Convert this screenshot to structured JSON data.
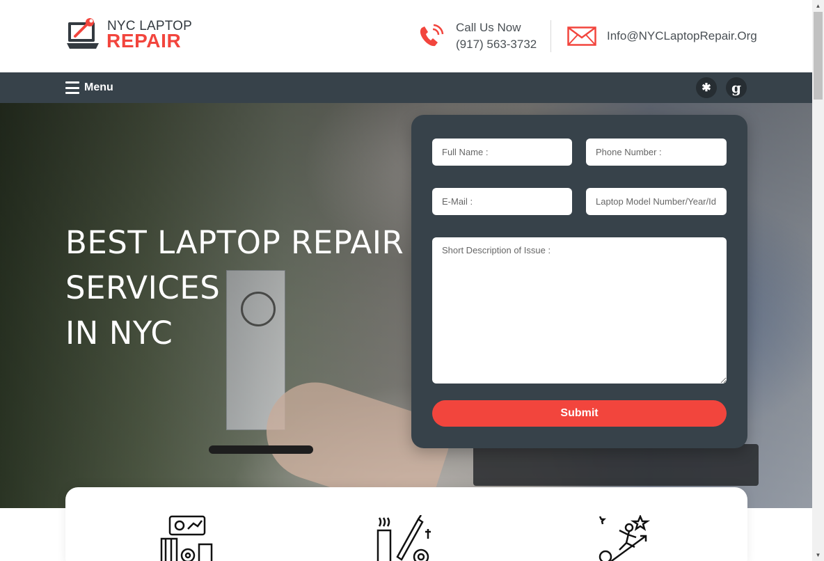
{
  "header": {
    "logo_line1": "NYC LAPTOP",
    "logo_line2": "REPAIR",
    "call_label": "Call Us Now",
    "call_number": "(917) 563-3732",
    "email": "Info@NYCLaptopRepair.Org"
  },
  "nav": {
    "menu_label": "Menu",
    "social": [
      {
        "icon": "yelp-icon",
        "glyph": "✱"
      },
      {
        "icon": "google-icon",
        "glyph": "g"
      }
    ]
  },
  "hero": {
    "title_line1": "BEST LAPTOP REPAIR",
    "title_line2": "SERVICES",
    "title_line3": "IN NYC"
  },
  "form": {
    "full_name_placeholder": "Full Name :",
    "phone_placeholder": "Phone Number :",
    "email_placeholder": "E-Mail :",
    "model_placeholder": "Laptop Model Number/Year/Id :",
    "description_placeholder": "Short Description of Issue :",
    "submit_label": "Submit"
  },
  "services": {
    "icons": [
      "business-growth-icon",
      "repair-tools-icon",
      "success-climb-icon"
    ]
  },
  "colors": {
    "accent": "#f2453d",
    "dark": "#37424a",
    "text": "#4a5055"
  }
}
